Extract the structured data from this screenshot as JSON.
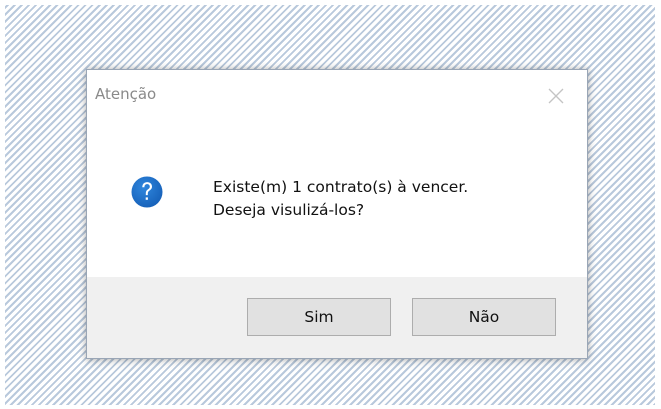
{
  "dialog": {
    "title": "Atenção",
    "icon": "question-icon",
    "message_line1": "Existe(m) 1 contrato(s) à vencer.",
    "message_line2": "Deseja visulizá-los?",
    "buttons": {
      "yes_label": "Sim",
      "no_label": "Não"
    }
  },
  "colors": {
    "icon_blue": "#1f6fc5",
    "footer_gray": "#f0f0f0",
    "button_face": "#e1e1e1",
    "backdrop_stripe": "#b9c9dc"
  }
}
